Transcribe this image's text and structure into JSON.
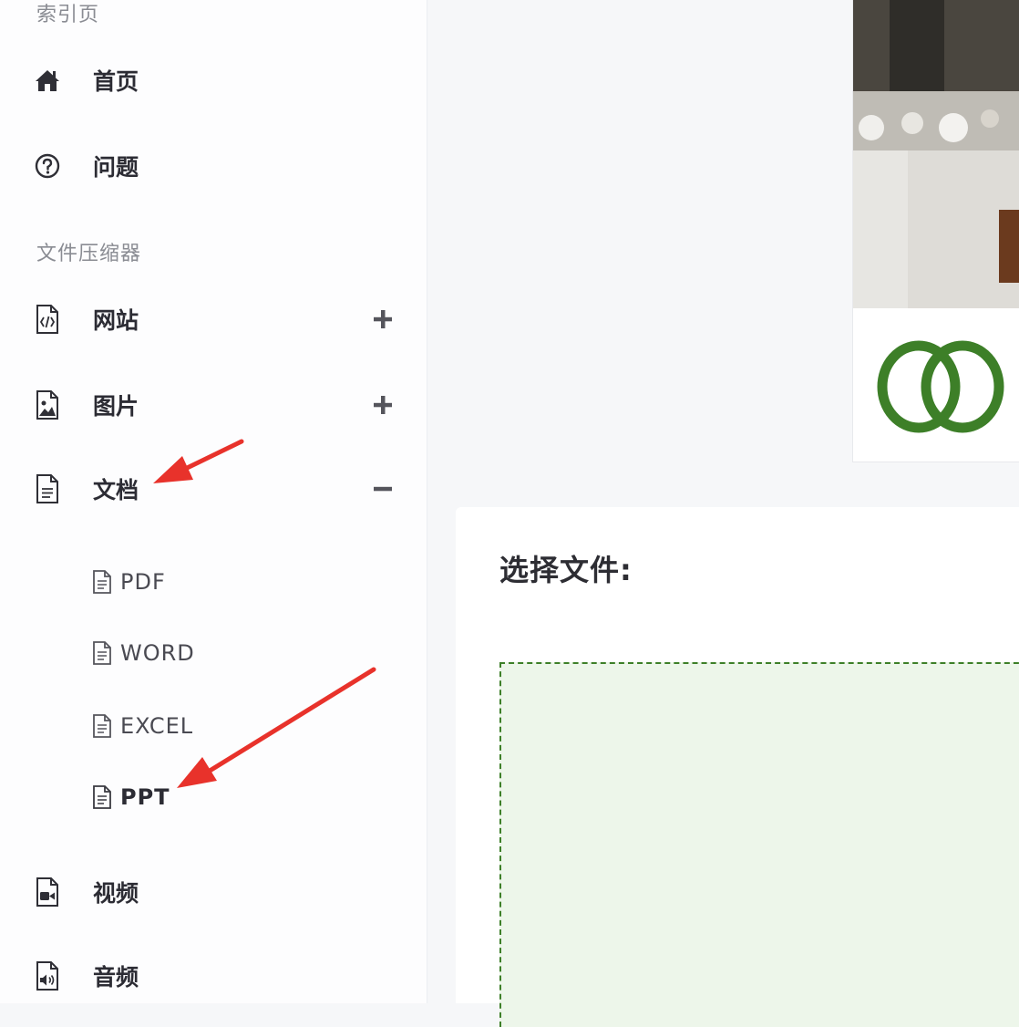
{
  "sidebar": {
    "section_index": "索引页",
    "index_items": [
      {
        "label": "首页",
        "icon": "home-icon"
      },
      {
        "label": "问题",
        "icon": "help-circle-icon"
      }
    ],
    "section_compressor": "文件压缩器",
    "compressor_items": [
      {
        "label": "网站",
        "icon": "code-file-icon",
        "toggle": "+"
      },
      {
        "label": "图片",
        "icon": "image-file-icon",
        "toggle": "+"
      },
      {
        "label": "文档",
        "icon": "document-file-icon",
        "toggle": "−",
        "expanded": true
      },
      {
        "label": "视频",
        "icon": "video-file-icon"
      },
      {
        "label": "音频",
        "icon": "audio-file-icon"
      }
    ],
    "document_subitems": [
      {
        "label": "PDF"
      },
      {
        "label": "WORD"
      },
      {
        "label": "EXCEL"
      },
      {
        "label": "PPT",
        "selected": true
      }
    ]
  },
  "main": {
    "select_title": "选择文件:"
  },
  "colors": {
    "brand_green": "#3d7f28",
    "drop_bg": "#edf6ea",
    "annotation_red": "#e8322b"
  }
}
